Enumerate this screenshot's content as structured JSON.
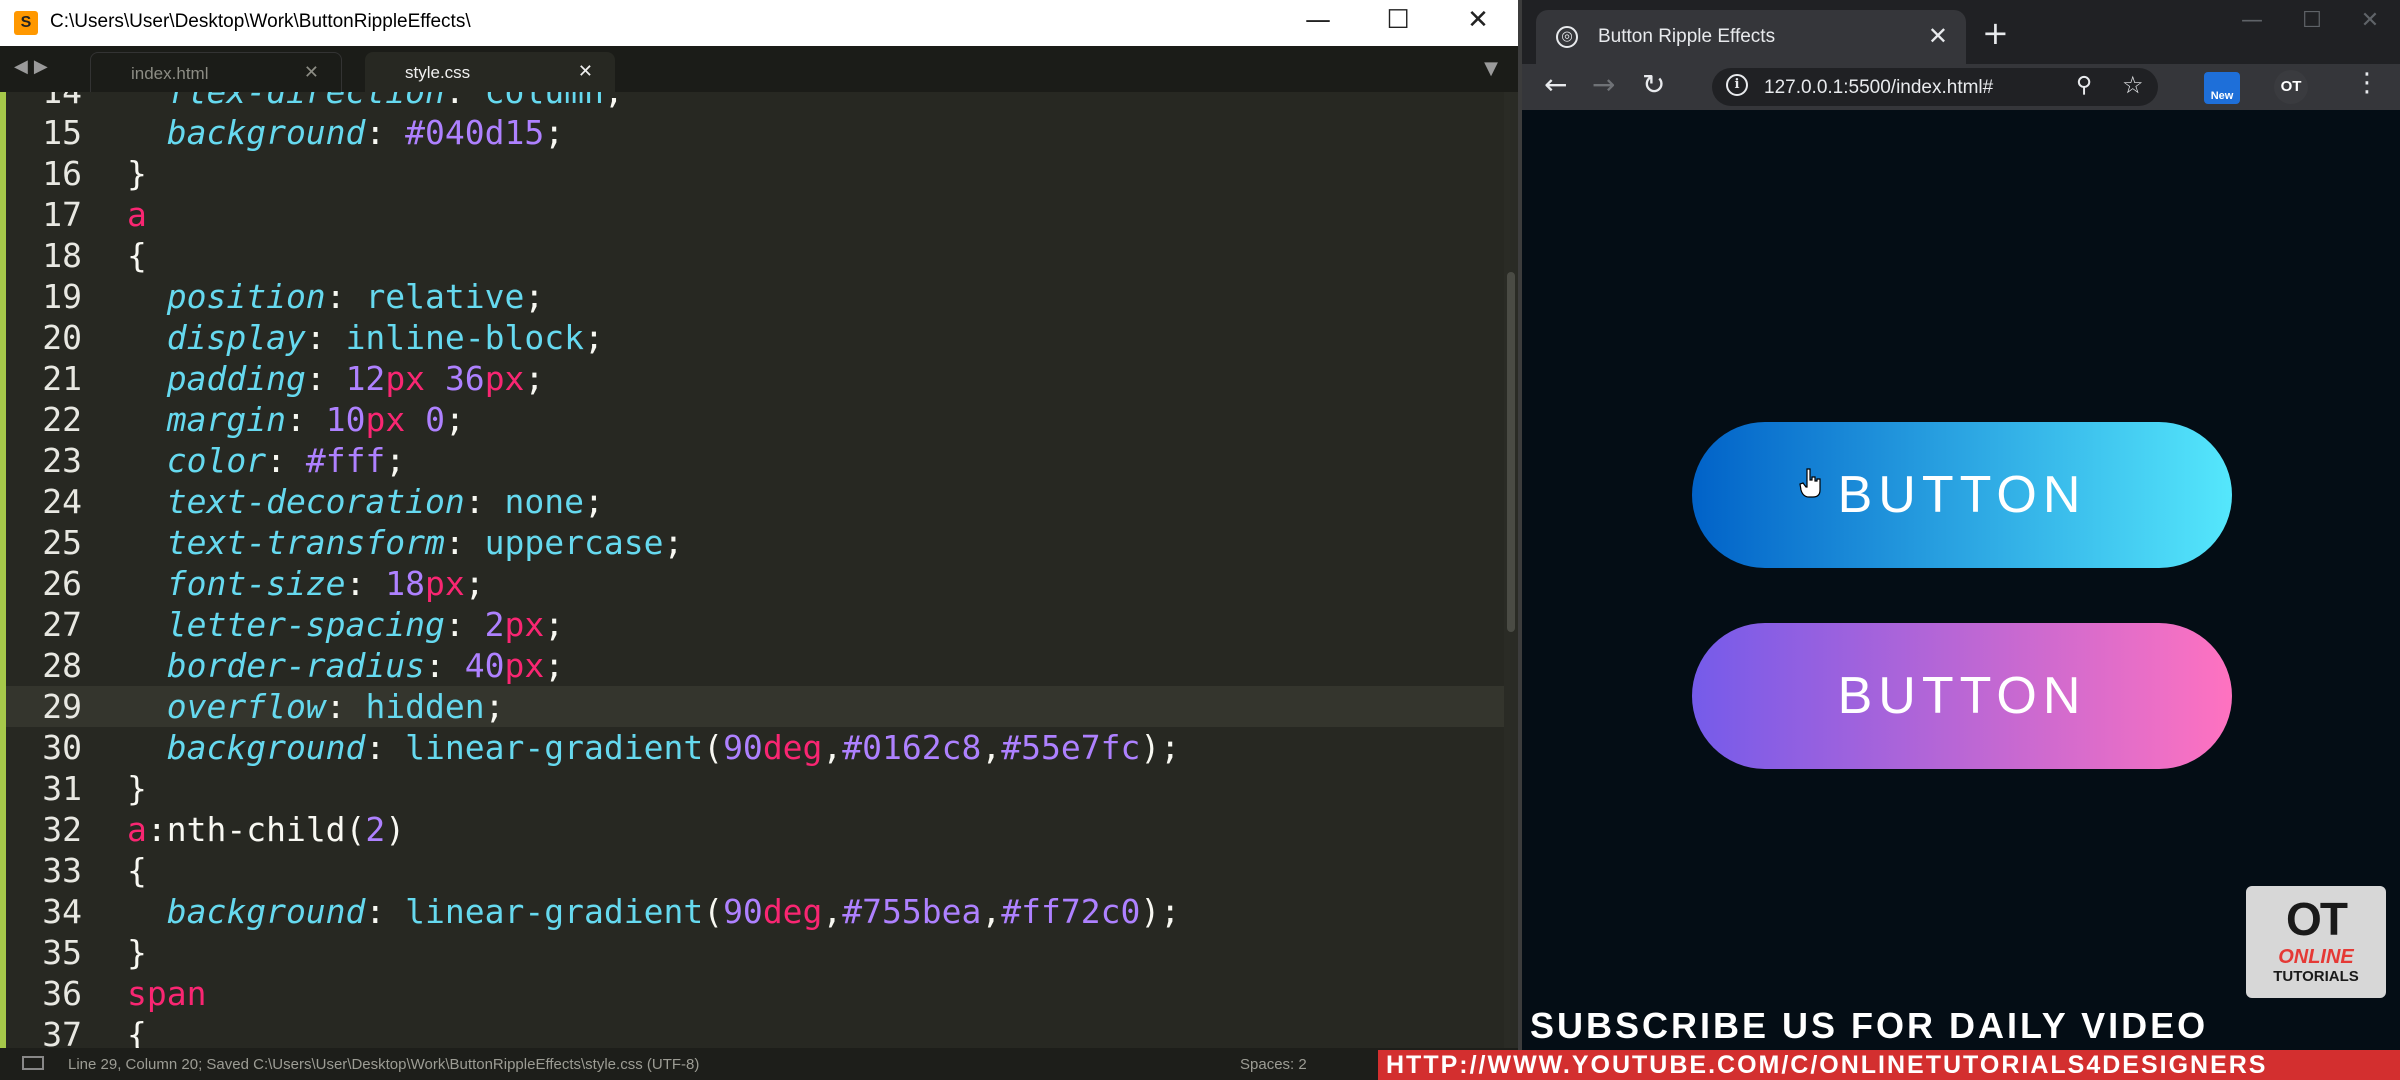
{
  "editor": {
    "title": "C:\\Users\\User\\Desktop\\Work\\ButtonRippleEffects\\",
    "app_icon": "sublime-text-icon",
    "window_controls": {
      "minimize": "—",
      "maximize": "☐",
      "close": "✕"
    },
    "tabs": [
      {
        "label": "index.html",
        "active": false
      },
      {
        "label": "style.css",
        "active": true
      }
    ],
    "current_line": 29,
    "code_lines": [
      {
        "n": "14",
        "tokens": [
          [
            "prop",
            "  flex-direction"
          ],
          [
            "pun",
            ": "
          ],
          [
            "val",
            "column"
          ],
          [
            "pun",
            ";"
          ]
        ]
      },
      {
        "n": "15",
        "tokens": [
          [
            "prop",
            "  background"
          ],
          [
            "pun",
            ": "
          ],
          [
            "num",
            "#040d15"
          ],
          [
            "pun",
            ";"
          ]
        ]
      },
      {
        "n": "16",
        "tokens": [
          [
            "pun",
            "}"
          ]
        ]
      },
      {
        "n": "17",
        "tokens": [
          [
            "sel",
            "a"
          ]
        ]
      },
      {
        "n": "18",
        "tokens": [
          [
            "pun",
            "{"
          ]
        ]
      },
      {
        "n": "19",
        "tokens": [
          [
            "prop",
            "  position"
          ],
          [
            "pun",
            ": "
          ],
          [
            "val",
            "relative"
          ],
          [
            "pun",
            ";"
          ]
        ]
      },
      {
        "n": "20",
        "tokens": [
          [
            "prop",
            "  display"
          ],
          [
            "pun",
            ": "
          ],
          [
            "val",
            "inline-block"
          ],
          [
            "pun",
            ";"
          ]
        ]
      },
      {
        "n": "21",
        "tokens": [
          [
            "prop",
            "  padding"
          ],
          [
            "pun",
            ": "
          ],
          [
            "num",
            "12"
          ],
          [
            "unit",
            "px"
          ],
          [
            "pun",
            " "
          ],
          [
            "num",
            "36"
          ],
          [
            "unit",
            "px"
          ],
          [
            "pun",
            ";"
          ]
        ]
      },
      {
        "n": "22",
        "tokens": [
          [
            "prop",
            "  margin"
          ],
          [
            "pun",
            ": "
          ],
          [
            "num",
            "10"
          ],
          [
            "unit",
            "px"
          ],
          [
            "pun",
            " "
          ],
          [
            "num",
            "0"
          ],
          [
            "pun",
            ";"
          ]
        ]
      },
      {
        "n": "23",
        "tokens": [
          [
            "prop",
            "  color"
          ],
          [
            "pun",
            ": "
          ],
          [
            "num",
            "#fff"
          ],
          [
            "pun",
            ";"
          ]
        ]
      },
      {
        "n": "24",
        "tokens": [
          [
            "prop",
            "  text-decoration"
          ],
          [
            "pun",
            ": "
          ],
          [
            "val",
            "none"
          ],
          [
            "pun",
            ";"
          ]
        ]
      },
      {
        "n": "25",
        "tokens": [
          [
            "prop",
            "  text-transform"
          ],
          [
            "pun",
            ": "
          ],
          [
            "val",
            "uppercase"
          ],
          [
            "pun",
            ";"
          ]
        ]
      },
      {
        "n": "26",
        "tokens": [
          [
            "prop",
            "  font-size"
          ],
          [
            "pun",
            ": "
          ],
          [
            "num",
            "18"
          ],
          [
            "unit",
            "px"
          ],
          [
            "pun",
            ";"
          ]
        ]
      },
      {
        "n": "27",
        "tokens": [
          [
            "prop",
            "  letter-spacing"
          ],
          [
            "pun",
            ": "
          ],
          [
            "num",
            "2"
          ],
          [
            "unit",
            "px"
          ],
          [
            "pun",
            ";"
          ]
        ]
      },
      {
        "n": "28",
        "tokens": [
          [
            "prop",
            "  border-radius"
          ],
          [
            "pun",
            ": "
          ],
          [
            "num",
            "40"
          ],
          [
            "unit",
            "px"
          ],
          [
            "pun",
            ";"
          ]
        ]
      },
      {
        "n": "29",
        "tokens": [
          [
            "prop",
            "  overflow"
          ],
          [
            "pun",
            ": "
          ],
          [
            "val",
            "hidden"
          ],
          [
            "pun",
            ";"
          ]
        ]
      },
      {
        "n": "30",
        "tokens": [
          [
            "prop",
            "  background"
          ],
          [
            "pun",
            ": "
          ],
          [
            "val",
            "linear-gradient"
          ],
          [
            "pun",
            "("
          ],
          [
            "num",
            "90"
          ],
          [
            "unit",
            "deg"
          ],
          [
            "pun",
            ","
          ],
          [
            "num",
            "#0162c8"
          ],
          [
            "pun",
            ","
          ],
          [
            "num",
            "#55e7fc"
          ],
          [
            "pun",
            ");"
          ]
        ]
      },
      {
        "n": "31",
        "tokens": [
          [
            "pun",
            "}"
          ]
        ]
      },
      {
        "n": "32",
        "tokens": [
          [
            "sel",
            "a"
          ],
          [
            "plain",
            ":nth-child("
          ],
          [
            "num",
            "2"
          ],
          [
            "plain",
            ")"
          ]
        ]
      },
      {
        "n": "33",
        "tokens": [
          [
            "pun",
            "{"
          ]
        ]
      },
      {
        "n": "34",
        "tokens": [
          [
            "prop",
            "  background"
          ],
          [
            "pun",
            ": "
          ],
          [
            "val",
            "linear-gradient"
          ],
          [
            "pun",
            "("
          ],
          [
            "num",
            "90"
          ],
          [
            "unit",
            "deg"
          ],
          [
            "pun",
            ","
          ],
          [
            "num",
            "#755bea"
          ],
          [
            "pun",
            ","
          ],
          [
            "num",
            "#ff72c0"
          ],
          [
            "pun",
            ");"
          ]
        ]
      },
      {
        "n": "35",
        "tokens": [
          [
            "pun",
            "}"
          ]
        ]
      },
      {
        "n": "36",
        "tokens": [
          [
            "sel",
            "span"
          ]
        ]
      },
      {
        "n": "37",
        "tokens": [
          [
            "pun",
            "{"
          ]
        ]
      }
    ],
    "status": {
      "message": "Line 29, Column 20; Saved C:\\Users\\User\\Desktop\\Work\\ButtonRippleEffects\\style.css (UTF-8)",
      "spaces": "Spaces: 2"
    }
  },
  "browser": {
    "tab_title": "Button Ripple Effects",
    "tab_close": "✕",
    "new_tab": "+",
    "url": "127.0.0.1:5500/index.html#",
    "ext_new_badge": "New",
    "ext_avatar": "OT",
    "page": {
      "background": "#040d15",
      "buttons": [
        {
          "label": "BUTTON",
          "gradient": [
            "#0162c8",
            "#55e7fc"
          ]
        },
        {
          "label": "BUTTON",
          "gradient": [
            "#755bea",
            "#ff72c0"
          ]
        }
      ]
    }
  },
  "overlays": {
    "logo_mark": "OT",
    "logo_line1": "ONLINE",
    "logo_line2": "TUTORIALS",
    "subscribe": "SUBSCRIBE US FOR DAILY VIDEO",
    "url": "HTTP://WWW.YOUTUBE.COM/C/ONLINETUTORIALS4DESIGNERS"
  },
  "colors": {
    "editor_bg": "#272822",
    "selector": "#f92672",
    "property": "#66d9ef",
    "number": "#ae81ff",
    "overlay_red": "#d32f2f"
  }
}
